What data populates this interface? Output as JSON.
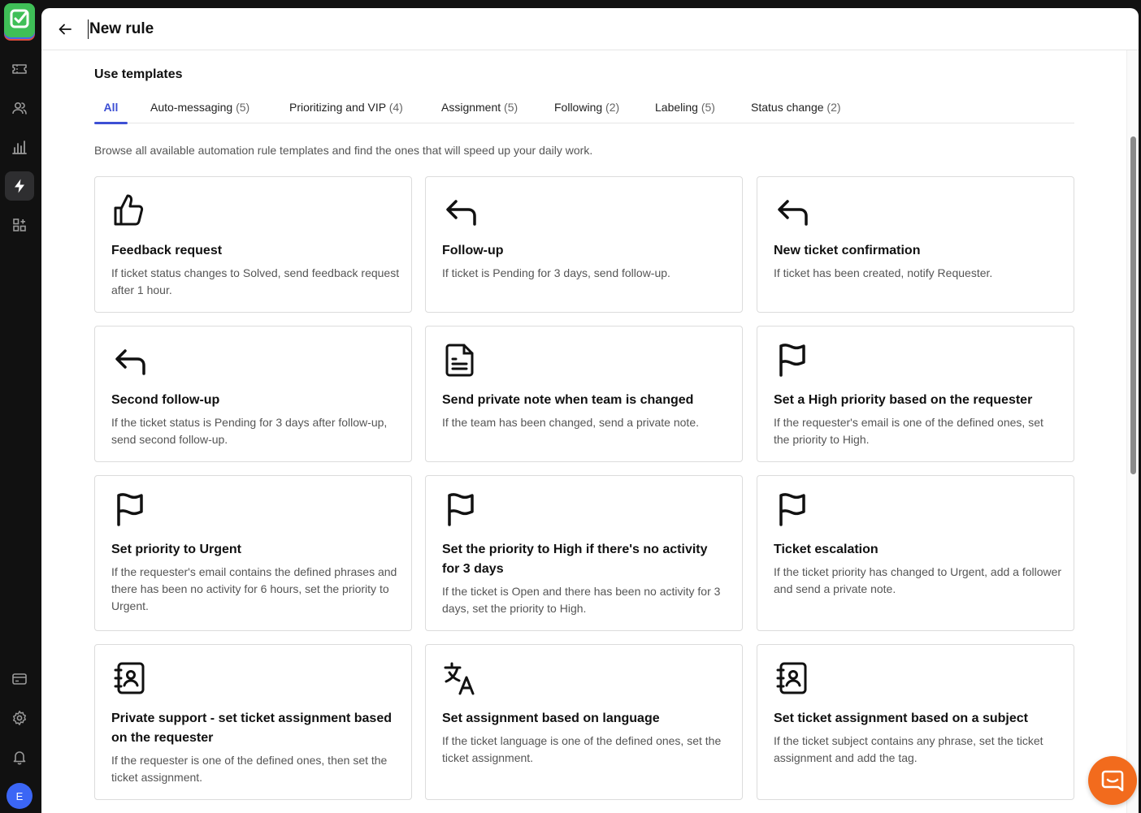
{
  "header": {
    "title": "New rule"
  },
  "section": {
    "title": "Use templates",
    "description": "Browse all available automation rule templates and find the ones that will speed up your daily work."
  },
  "tabs": [
    {
      "label": "All",
      "count": ""
    },
    {
      "label": "Auto-messaging",
      "count": "(5)"
    },
    {
      "label": "Prioritizing and VIP",
      "count": "(4)"
    },
    {
      "label": "Assignment",
      "count": "(5)"
    },
    {
      "label": "Following",
      "count": "(2)"
    },
    {
      "label": "Labeling",
      "count": "(5)"
    },
    {
      "label": "Status change",
      "count": "(2)"
    }
  ],
  "cards": [
    {
      "icon": "thumbs-up-icon",
      "title": "Feedback request",
      "description": "If ticket status changes to Solved, send feedback request after 1 hour."
    },
    {
      "icon": "reply-arrow-icon",
      "title": "Follow-up",
      "description": "If ticket is Pending for 3 days, send follow-up."
    },
    {
      "icon": "reply-arrow-icon",
      "title": "New ticket confirmation",
      "description": "If ticket has been created, notify Requester."
    },
    {
      "icon": "reply-arrow-icon",
      "title": "Second follow-up",
      "description": "If the ticket status is Pending for 3 days after follow-up, send second follow-up."
    },
    {
      "icon": "document-icon",
      "title": "Send private note when team is changed",
      "description": "If the team has been changed, send a private note."
    },
    {
      "icon": "flag-icon",
      "title": "Set a High priority based on the requester",
      "description": "If the requester's email is one of the defined ones, set the priority to High."
    },
    {
      "icon": "flag-icon",
      "title": "Set priority to Urgent",
      "description": "If the requester's email contains the defined phrases and there has been no activity for 6 hours, set the priority to Urgent."
    },
    {
      "icon": "flag-icon",
      "title": "Set the priority to High if there's no activity for 3 days",
      "description": "If the ticket is Open and there has been no activity for 3 days, set the priority to High."
    },
    {
      "icon": "flag-icon",
      "title": "Ticket escalation",
      "description": "If the ticket priority has changed to Urgent, add a follower and send a private note."
    },
    {
      "icon": "contact-book-icon",
      "title": "Private support - set ticket assignment based on the requester",
      "description": "If the requester is one of the defined ones, then set the ticket assignment."
    },
    {
      "icon": "translate-icon",
      "title": "Set assignment based on language",
      "description": "If the ticket language is one of the defined ones, set the ticket assignment."
    },
    {
      "icon": "contact-book-icon",
      "title": "Set ticket assignment based on a subject",
      "description": "If the ticket subject contains any phrase, set the ticket assignment and add the tag."
    }
  ],
  "sidebar": {
    "items": [
      {
        "name": "tickets-icon"
      },
      {
        "name": "customers-icon"
      },
      {
        "name": "reports-icon"
      },
      {
        "name": "automation-icon",
        "active": true
      },
      {
        "name": "apps-icon"
      },
      {
        "name": "billing-icon"
      },
      {
        "name": "settings-icon"
      },
      {
        "name": "notifications-icon"
      }
    ],
    "avatar_initial": "E"
  },
  "colors": {
    "accent": "#3d4fd4",
    "chat": "#f26b1d",
    "logo": "#3fbf57"
  }
}
